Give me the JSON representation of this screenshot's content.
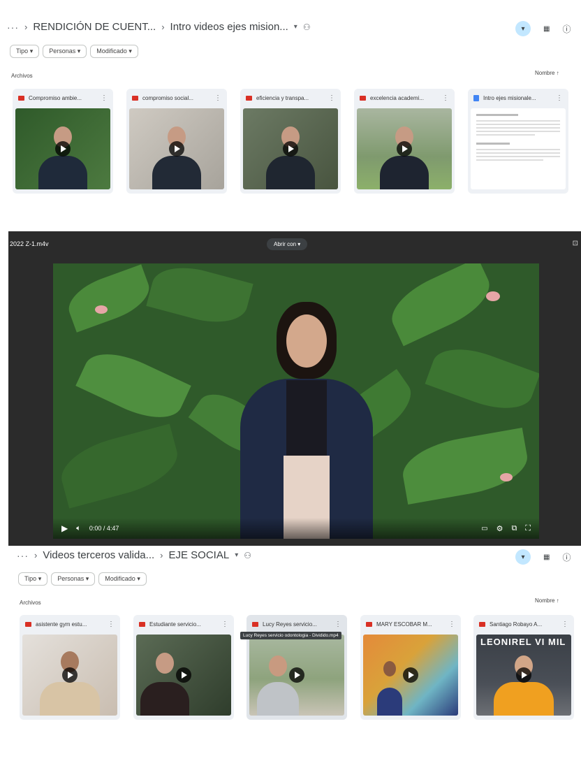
{
  "top_panel": {
    "breadcrumb": {
      "more": "···",
      "parent": "RENDICIÓN DE CUENT...",
      "current": "Intro videos ejes mision..."
    },
    "filters": [
      "Tipo",
      "Personas",
      "Modificado"
    ],
    "section_label": "Archivos",
    "sort_label": "Nombre",
    "files": [
      {
        "name": "Compromiso ambie...",
        "kind": "video",
        "thumb_colors": [
          "#2f5a2a",
          "#1f2a3a"
        ]
      },
      {
        "name": "compromiso social...",
        "kind": "video",
        "thumb_colors": [
          "#b7b4ad",
          "#222a36"
        ]
      },
      {
        "name": "eficiencia y transpa...",
        "kind": "video",
        "thumb_colors": [
          "#5c6b55",
          "#1f2630"
        ]
      },
      {
        "name": "excelencia academi...",
        "kind": "video",
        "thumb_colors": [
          "#8aa37a",
          "#1e2430"
        ]
      },
      {
        "name": "Intro ejes misionale...",
        "kind": "doc",
        "thumb_colors": [
          "#ffffff",
          "#ffffff"
        ]
      }
    ]
  },
  "viewer": {
    "filename": "2022 Z-1.m4v",
    "open_with": "Abrir con",
    "time": "0:00 / 4:47",
    "accent": "#000000"
  },
  "bottom_panel": {
    "breadcrumb": {
      "more": "···",
      "parent": "Videos terceros valida...",
      "current": "EJE SOCIAL"
    },
    "filters": [
      "Tipo",
      "Personas",
      "Modificado"
    ],
    "section_label": "Archivos",
    "sort_label": "Nombre",
    "tooltip": "Lucy Reyes servicio odontologia - Dividido.mp4",
    "files": [
      {
        "name": "asistente gym estu...",
        "kind": "video",
        "thumb_colors": [
          "#d9d4cf",
          "#d8c4a5"
        ]
      },
      {
        "name": "Estudiante servicio...",
        "kind": "video",
        "thumb_colors": [
          "#4a5a45",
          "#222"
        ]
      },
      {
        "name": "Lucy Reyes servicio...",
        "kind": "video",
        "thumb_colors": [
          "#9eb08a",
          "#bfc3c7"
        ]
      },
      {
        "name": "MARY ESCOBAR M...",
        "kind": "video",
        "thumb_colors": [
          "#e48a3a",
          "#2b3b7a"
        ]
      },
      {
        "name": "Santiago Robayo A...",
        "kind": "video",
        "thumb_colors": [
          "#3a3f46",
          "#f0a020"
        ],
        "overlay": "LEONIREL VI  MIL"
      }
    ]
  },
  "colors": {
    "drive_accent": "#c2e7ff",
    "video_icon": "#d93025",
    "doc_icon": "#4285f4"
  }
}
